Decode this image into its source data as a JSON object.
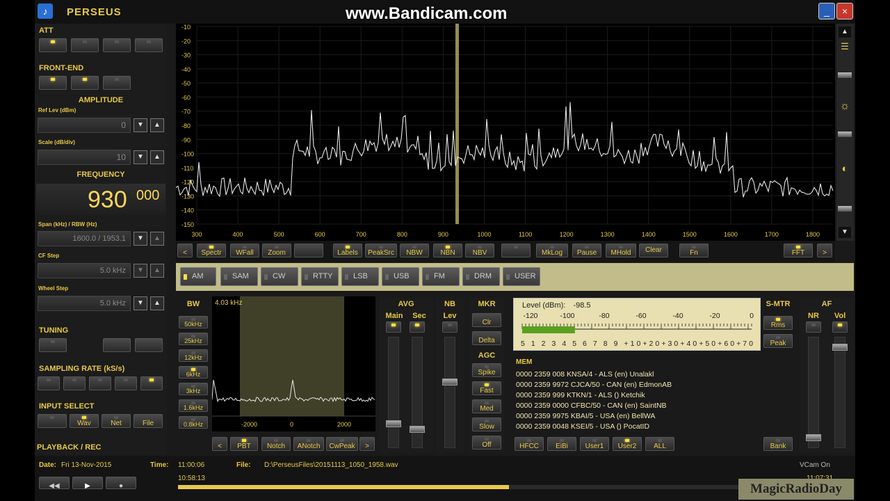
{
  "window": {
    "title": "PERSEUS",
    "watermark": "www.Bandicam.com",
    "minimize": "_",
    "close": "×"
  },
  "left": {
    "att_label": "ATT",
    "frontend_label": "FRONT-END",
    "amplitude_label": "AMPLITUDE",
    "reflev_label": "Ref Lev (dBm)",
    "reflev_value": "0",
    "scale_label": "Scale (dB/div)",
    "scale_value": "10",
    "frequency_label": "FREQUENCY",
    "freq_main": "930",
    "freq_frac": "000",
    "span_label": "Span (kHz) / RBW (Hz)",
    "span_value": "1600.0 / 1953.1",
    "cfstep_label": "CF Step",
    "cfstep_value": "5.0 kHz",
    "wheelstep_label": "Wheel Step",
    "wheelstep_value": "5.0 kHz",
    "tuning_label": "TUNING",
    "sampling_label": "SAMPLING RATE (kS/s)",
    "input_label": "INPUT SELECT",
    "input_buttons": [
      "Wav",
      "Net",
      "File"
    ],
    "playback_label": "PLAYBACK / REC"
  },
  "spectrum": {
    "y_ticks": [
      "-10",
      "-20",
      "-30",
      "-40",
      "-50",
      "-60",
      "-70",
      "-80",
      "-90",
      "-100",
      "-110",
      "-120",
      "-130",
      "-140",
      "-150"
    ],
    "x_ticks": [
      "300",
      "400",
      "500",
      "600",
      "700",
      "800",
      "900",
      "1000",
      "1100",
      "1200",
      "1300",
      "1400",
      "1500",
      "1600",
      "1700",
      "1800"
    ]
  },
  "toolbar": {
    "left_arrow": "<",
    "buttons": [
      "Spectr",
      "WFall",
      "Zoom",
      "",
      "Labels",
      "PeakSrc",
      "NBW",
      "NBN",
      "NBV",
      "",
      "MkLog",
      "Pause",
      "MHold",
      "Clear",
      "Fn",
      "FFT"
    ],
    "right_arrow": ">"
  },
  "modes": [
    "AM",
    "SAM",
    "CW",
    "RTTY",
    "LSB",
    "USB",
    "FM",
    "DRM",
    "USER"
  ],
  "bw": {
    "label": "BW",
    "buttons": [
      "50kHz",
      "25kHz",
      "12kHz",
      "6kHz",
      "3kHz",
      "1.6kHz",
      "0.8kHz"
    ],
    "readout": "4.03 kHz",
    "x_ticks": [
      "-2000",
      "0",
      "2000"
    ]
  },
  "filter_buttons": [
    "<",
    "PBT",
    "Notch",
    "ANotch",
    "CwPeak",
    ">"
  ],
  "avg": {
    "label": "AVG",
    "main": "Main",
    "sec": "Sec"
  },
  "nb": {
    "label": "NB",
    "lev": "Lev"
  },
  "mkr": {
    "label": "MKR",
    "buttons": [
      "Clr",
      "Delta"
    ]
  },
  "agc": {
    "label": "AGC",
    "buttons": [
      "Spike",
      "Fast",
      "Med",
      "Slow",
      "Off"
    ]
  },
  "smeter": {
    "label": "S-MTR",
    "level_label": "Level (dBm):",
    "level_value": "-98.5",
    "dbm_ticks": [
      "-120",
      "-100",
      "-80",
      "-60",
      "-40",
      "-20",
      "0"
    ],
    "s_ticks": "5  1  2  3  4  5  6  7  8  9  +10+20+30+40+50+60+70",
    "level_fraction": 0.23,
    "buttons": [
      "Rms",
      "Peak"
    ]
  },
  "mem": {
    "label": "MEM",
    "lines": [
      "0000 2359 008 KNSA/4 - ALS (en)  Unalakl",
      "0000 2359 9972 CJCA/50 - CAN (en)  EdmonAB",
      "0000 2359 999 KTKN/1 - ALS ()  Ketchik",
      "0000 2359 0000 CFBC/50 - CAN (en)  SaintNB",
      "0000 2359 9975 KBAI/5 - USA (en)  BellWA",
      "0000 2359 0048 KSEI/5 - USA ()  PocatID"
    ],
    "buttons": [
      "HFCC",
      "EiBi",
      "User1",
      "User2",
      "ALL"
    ],
    "bank": "Bank"
  },
  "af": {
    "label": "AF",
    "nr": "NR",
    "vol": "Vol"
  },
  "bottom": {
    "date_label": "Date:",
    "date_value": "Fri 13-Nov-2015",
    "time_label": "Time:",
    "time_value": "11:00:06",
    "file_label": "File:",
    "file_value": "D:\\PerseusFiles\\20151113_1050_1958.wav",
    "start_time": "10:58:13",
    "end_time": "11:07:31",
    "vcam": "VCam On",
    "channel_watermark": "MagicRadioDay",
    "playback_progress": 0.49
  },
  "colors": {
    "accent": "#e8c94a",
    "trace": "#e6e6e6",
    "mode_bar": "#c2bc8a",
    "cursor": "#c8bb6a"
  }
}
